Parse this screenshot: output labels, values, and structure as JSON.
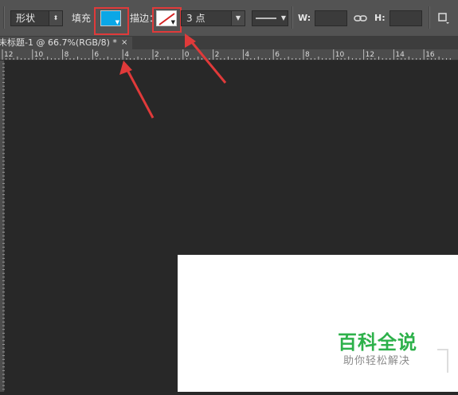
{
  "options_bar": {
    "mode_select": "形状",
    "fill_label": "填充",
    "stroke_label": "描边：",
    "stroke_width_value": "3 点",
    "width_label": "W:",
    "height_label": "H:",
    "fill_color": "#0aa7e6",
    "stroke_color": "none"
  },
  "document_tab": {
    "title": "未标题-1 @ 66.7%(RGB/8) *",
    "close": "×"
  },
  "ruler": {
    "labels": [
      "12",
      "10",
      "8",
      "6",
      "4",
      "2",
      "0",
      "2",
      "4",
      "6",
      "8",
      "10",
      "12",
      "14",
      "16"
    ]
  },
  "watermark": {
    "title": "百科全说",
    "subtitle": "助你轻松解决"
  },
  "colors": {
    "annotation_red": "#e03a3a",
    "watermark_green": "#2db14a"
  }
}
